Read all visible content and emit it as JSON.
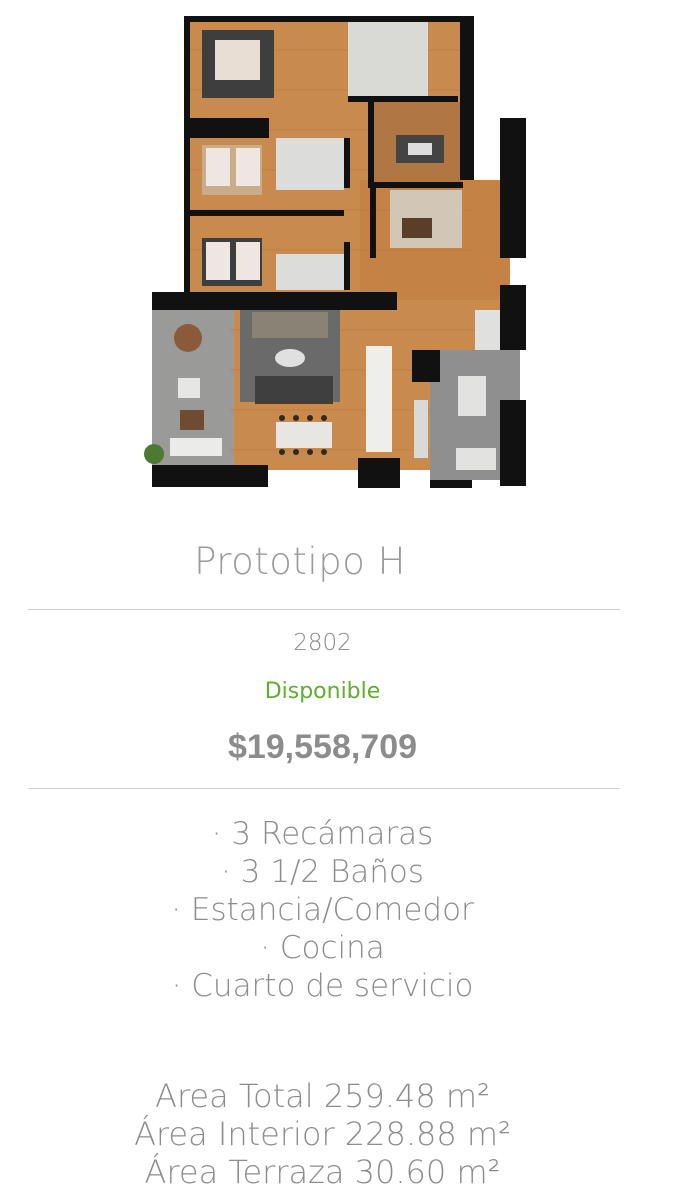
{
  "floorplan": {
    "alt": "Floor plan Prototipo H"
  },
  "title": "Prototipo H",
  "unit_number": "2802",
  "status": "Disponible",
  "price": "$19,558,709",
  "features": [
    "· 3 Recámaras",
    "· 3 1/2 Baños",
    "· Estancia/Comedor",
    "· Cocina",
    "· Cuarto de servicio"
  ],
  "areas": [
    "Area Total 259.48 m²",
    "Área Interior 228.88 m²",
    "Área Terraza 30.60 m²"
  ],
  "colors": {
    "status_green": "#5fae2f",
    "text_gray": "#8c8c8c",
    "floor_wood": "#c8874a",
    "wall_black": "#111111"
  }
}
